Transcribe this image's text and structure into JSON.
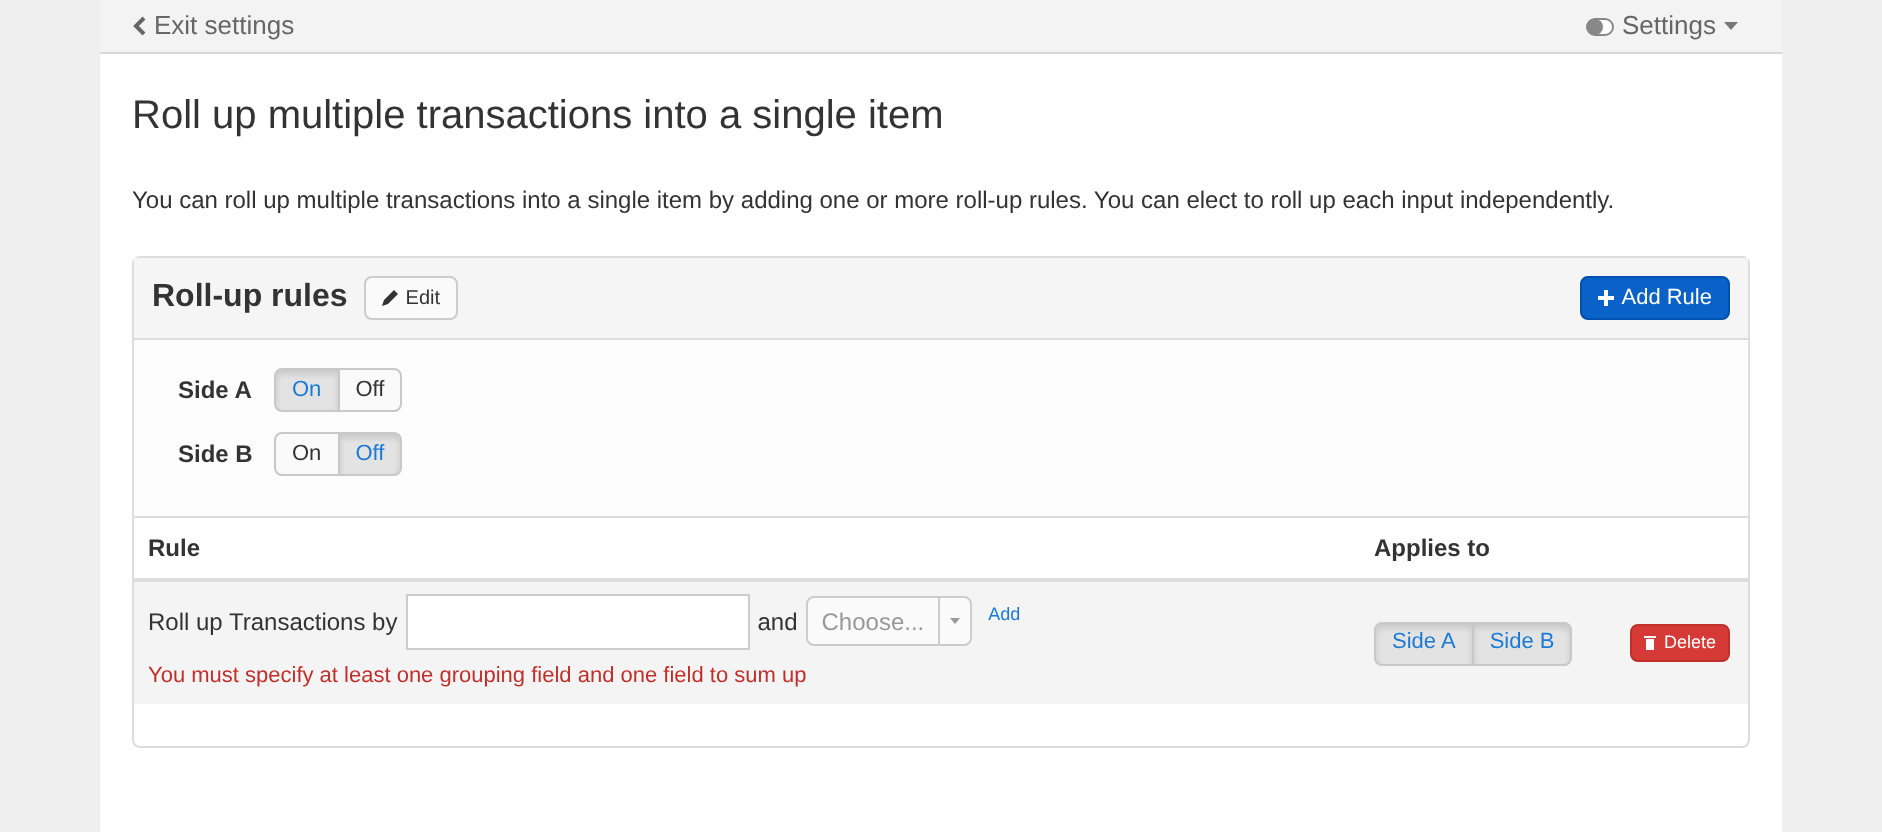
{
  "top_bar": {
    "back_link": "Exit settings",
    "settings_menu": "Settings"
  },
  "title": "Roll up multiple transactions into a single item",
  "description": "You can roll up multiple transactions into a single item by adding one or more roll-up rules. You can elect to roll up each input independently.",
  "panel": {
    "title": "Roll-up rules",
    "edit_button": "Edit",
    "add_button": "Add Rule",
    "sides": [
      {
        "label": "Side A",
        "options": [
          {
            "label": "On",
            "selected": true
          },
          {
            "label": "Off",
            "selected": false
          }
        ]
      },
      {
        "label": "Side B",
        "options": [
          {
            "label": "On",
            "selected": false
          },
          {
            "label": "Off",
            "selected": true
          }
        ]
      }
    ]
  },
  "table": {
    "columns": [
      "Rule",
      "Applies to"
    ],
    "rows": [
      {
        "prefix": "Roll up Transactions by",
        "and": "and",
        "select_placeholder": "Choose...",
        "add_link": "Add",
        "error": "You must specify at least one grouping field and one field to sum up",
        "applies_to": [
          {
            "label": "Side A",
            "selected": true
          },
          {
            "label": "Side B",
            "selected": true
          }
        ],
        "delete_button": "Delete"
      }
    ]
  }
}
